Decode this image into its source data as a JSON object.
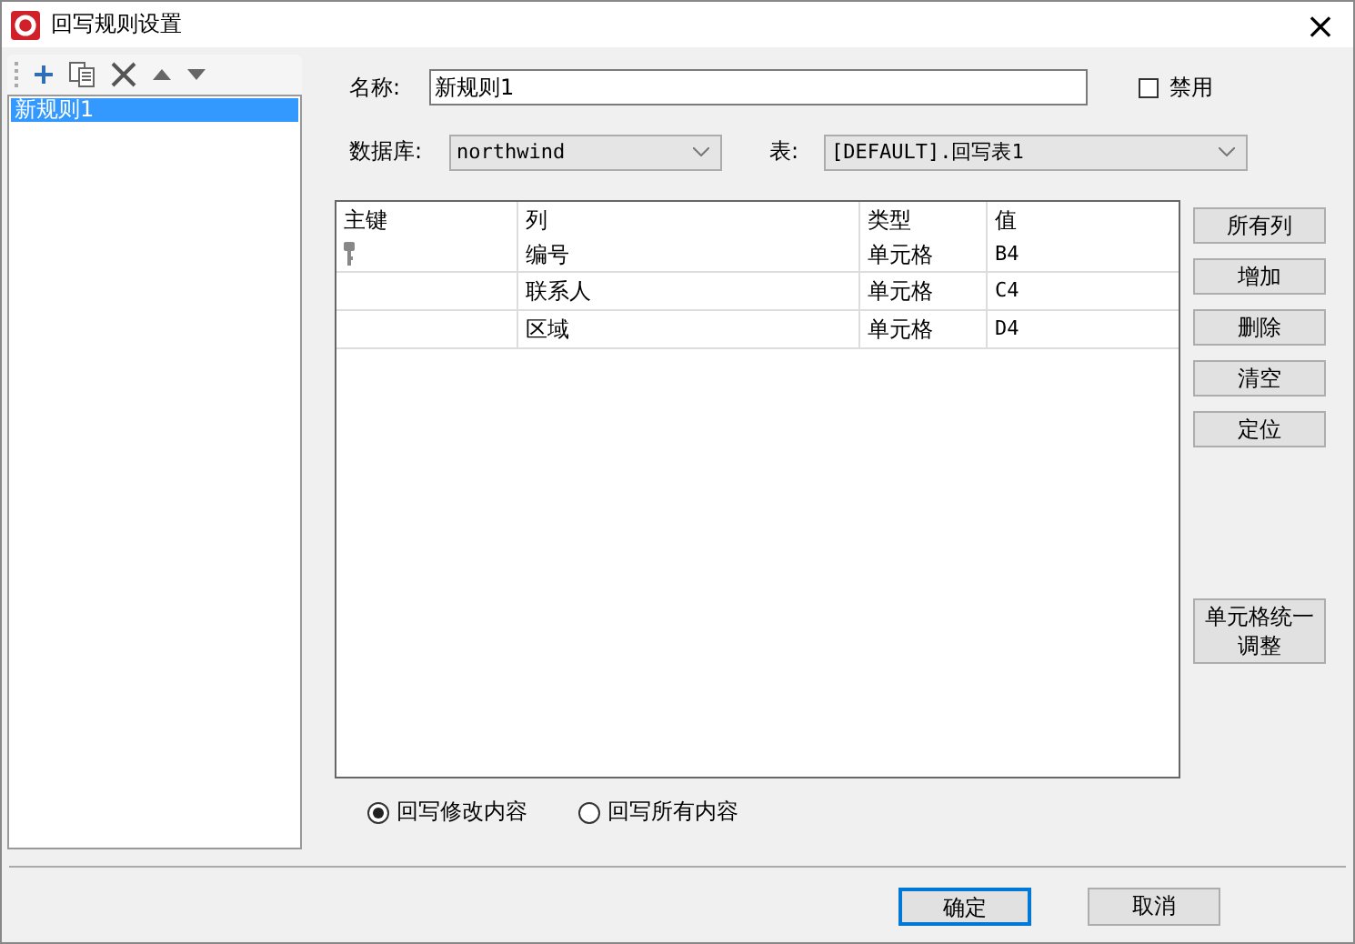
{
  "window": {
    "title": "回写规则设置",
    "close": "×"
  },
  "sidebar": {
    "items": [
      {
        "label": "新规则1",
        "selected": true
      }
    ]
  },
  "form": {
    "name_label": "名称:",
    "name_value": "新规则1",
    "disabled_label": "禁用",
    "disabled": false,
    "db_label": "数据库:",
    "db_value": "northwind",
    "table_label": "表:",
    "table_value": "[DEFAULT].回写表1"
  },
  "table": {
    "columns": [
      "主键",
      "列",
      "类型",
      "值"
    ],
    "rows": [
      {
        "primary_key": true,
        "column": "编号",
        "type": "单元格",
        "value": "B4"
      },
      {
        "primary_key": false,
        "column": "联系人",
        "type": "单元格",
        "value": "C4"
      },
      {
        "primary_key": false,
        "column": "区域",
        "type": "单元格",
        "value": "D4"
      }
    ]
  },
  "side_buttons": [
    "所有列",
    "增加",
    "删除",
    "清空",
    "定位"
  ],
  "adjust_button": "单元格统一调整",
  "modes": [
    {
      "label": "回写修改内容",
      "selected": true
    },
    {
      "label": "回写所有内容",
      "selected": false
    }
  ],
  "buttons": [
    {
      "label": "确定",
      "default": true
    },
    {
      "label": "取消",
      "default": false
    }
  ]
}
